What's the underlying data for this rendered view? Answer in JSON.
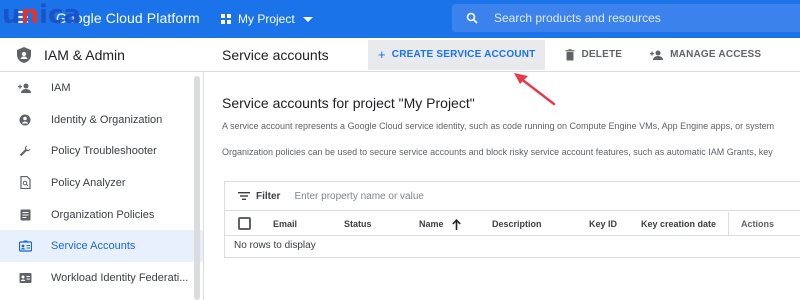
{
  "watermark": {
    "part1": "u",
    "part2": "n",
    "part3": "ica"
  },
  "topbar": {
    "product": "Google Cloud Platform",
    "project": "My Project",
    "search_placeholder": "Search products and resources"
  },
  "sidebar": {
    "title": "IAM & Admin",
    "items": [
      {
        "label": "IAM",
        "icon": "person-add-icon"
      },
      {
        "label": "Identity & Organization",
        "icon": "account-circle-icon"
      },
      {
        "label": "Policy Troubleshooter",
        "icon": "wrench-icon"
      },
      {
        "label": "Policy Analyzer",
        "icon": "document-search-icon"
      },
      {
        "label": "Organization Policies",
        "icon": "list-document-icon"
      },
      {
        "label": "Service Accounts",
        "icon": "service-account-icon"
      },
      {
        "label": "Workload Identity Federati...",
        "icon": "workload-identity-icon"
      }
    ],
    "active_index": 5
  },
  "header": {
    "page_title": "Service accounts",
    "create_label": "CREATE SERVICE ACCOUNT",
    "delete_label": "DELETE",
    "manage_label": "MANAGE ACCESS"
  },
  "content": {
    "heading": "Service accounts for project \"My Project\"",
    "desc1": "A service account represents a Google Cloud service identity, such as code running on Compute Engine VMs, App Engine apps, or system",
    "desc2": "Organization policies can be used to secure service accounts and block risky service account features, such as automatic IAM Grants, key"
  },
  "table": {
    "filter_label": "Filter",
    "filter_placeholder": "Enter property name or value",
    "columns": [
      "Email",
      "Status",
      "Name",
      "Description",
      "Key ID",
      "Key creation date",
      "Actions"
    ],
    "empty_text": "No rows to display"
  },
  "colors": {
    "topbar": "#1a73e8",
    "accent": "#1a73e8",
    "active_bg": "#e8f0fe",
    "arrow": "#e53b4a"
  }
}
